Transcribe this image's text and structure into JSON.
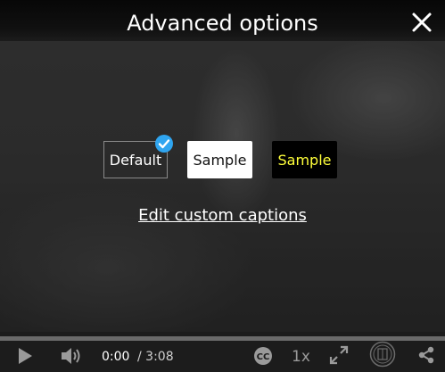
{
  "dialog": {
    "title": "Advanced options"
  },
  "caption_styles": [
    {
      "label": "Default",
      "selected": true
    },
    {
      "label": "Sample",
      "background": "#ffffff",
      "color": "#111111",
      "selected": false
    },
    {
      "label": "Sample",
      "background": "#000000",
      "color": "#ffff3a",
      "selected": false
    }
  ],
  "edit_custom_captions": "Edit custom captions",
  "player": {
    "current_time": "0:00",
    "total_time": "/ 3:08",
    "speed": "1x",
    "progress_fraction": 0.0
  },
  "icons": [
    "close-icon",
    "check-icon",
    "play-icon",
    "volume-icon",
    "closed-captions-icon",
    "fullscreen-icon",
    "logo-seal-icon",
    "share-icon"
  ],
  "colors": {
    "accent_check": "#2fa5f0",
    "caption_yellow": "#ffff3a"
  }
}
